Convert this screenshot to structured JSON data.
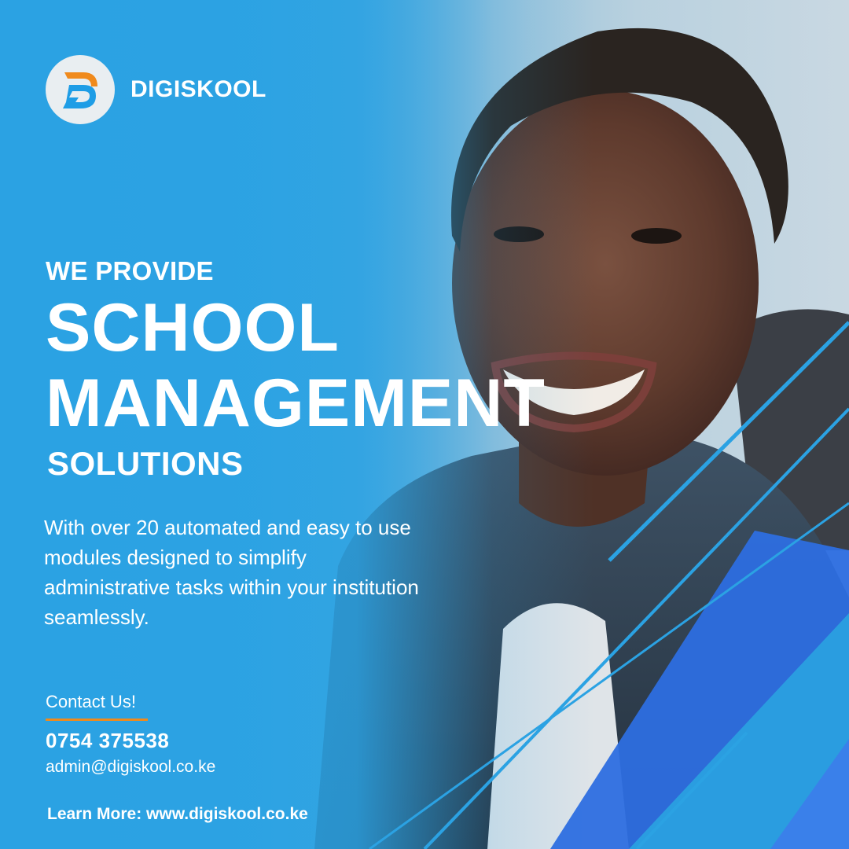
{
  "brand": {
    "name": "DIGISKOOL"
  },
  "headline": {
    "kicker": "WE PROVIDE",
    "line1": "SCHOOL",
    "line2": "MANAGEMENT",
    "tail": "SOLUTIONS"
  },
  "description": "With over 20 automated and easy to use modules designed to simplify administrative tasks within your institution seamlessly.",
  "contact": {
    "title": "Contact Us!",
    "phone": "0754 375538",
    "email": "admin@digiskool.co.ke"
  },
  "learn_more": {
    "label": "Learn More:",
    "url": "www.digiskool.co.ke"
  },
  "colors": {
    "primary_blue": "#2ba2e3",
    "deep_blue": "#2f6fe0",
    "accent_orange": "#f08a1c",
    "logo_blue": "#1e9de6"
  },
  "icons": {
    "logo": "digiskool-d-logo"
  }
}
